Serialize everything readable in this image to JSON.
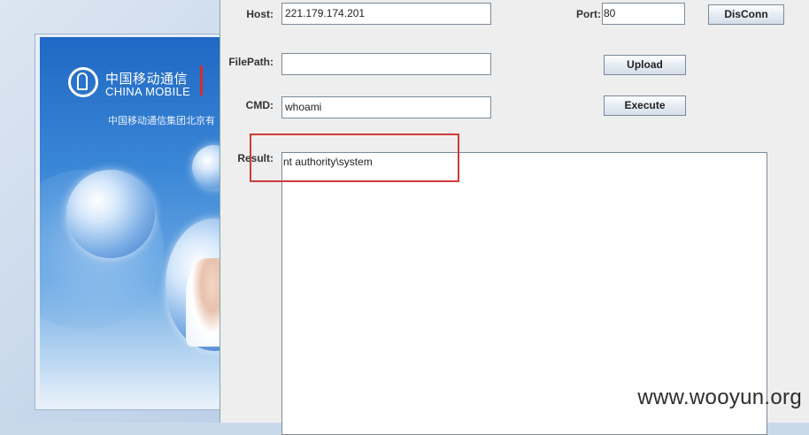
{
  "background": {
    "banner_cn_title": "中国移动通信",
    "banner_en_title": "CHINA MOBILE",
    "banner_subtitle": "中国移动通信集团北京有"
  },
  "dialog": {
    "host_label": "Host:",
    "host_value": "221.179.174.201",
    "port_label": "Port:",
    "port_value": "80",
    "disconn_label": "DisConn",
    "filepath_label": "FilePath:",
    "filepath_value": "",
    "upload_label": "Upload",
    "cmd_label": "CMD:",
    "cmd_value": "whoami",
    "execute_label": "Execute",
    "result_label": "Result:",
    "result_text": "nt authority\\system"
  },
  "watermark": "www.wooyun.org",
  "colors": {
    "highlight": "#d23a3a",
    "dialog_bg": "#eeeeee",
    "brand_blue": "#1f68c4"
  }
}
